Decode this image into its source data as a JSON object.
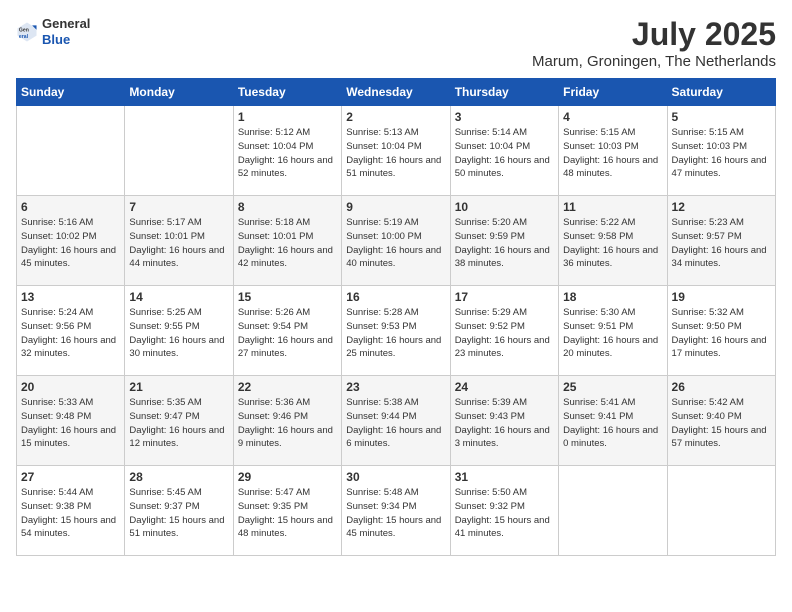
{
  "header": {
    "logo": {
      "general": "General",
      "blue": "Blue"
    },
    "title": "July 2025",
    "location": "Marum, Groningen, The Netherlands"
  },
  "calendar": {
    "weekdays": [
      "Sunday",
      "Monday",
      "Tuesday",
      "Wednesday",
      "Thursday",
      "Friday",
      "Saturday"
    ],
    "weeks": [
      [
        {
          "day": "",
          "sunrise": "",
          "sunset": "",
          "daylight": ""
        },
        {
          "day": "",
          "sunrise": "",
          "sunset": "",
          "daylight": ""
        },
        {
          "day": "1",
          "sunrise": "Sunrise: 5:12 AM",
          "sunset": "Sunset: 10:04 PM",
          "daylight": "Daylight: 16 hours and 52 minutes."
        },
        {
          "day": "2",
          "sunrise": "Sunrise: 5:13 AM",
          "sunset": "Sunset: 10:04 PM",
          "daylight": "Daylight: 16 hours and 51 minutes."
        },
        {
          "day": "3",
          "sunrise": "Sunrise: 5:14 AM",
          "sunset": "Sunset: 10:04 PM",
          "daylight": "Daylight: 16 hours and 50 minutes."
        },
        {
          "day": "4",
          "sunrise": "Sunrise: 5:15 AM",
          "sunset": "Sunset: 10:03 PM",
          "daylight": "Daylight: 16 hours and 48 minutes."
        },
        {
          "day": "5",
          "sunrise": "Sunrise: 5:15 AM",
          "sunset": "Sunset: 10:03 PM",
          "daylight": "Daylight: 16 hours and 47 minutes."
        }
      ],
      [
        {
          "day": "6",
          "sunrise": "Sunrise: 5:16 AM",
          "sunset": "Sunset: 10:02 PM",
          "daylight": "Daylight: 16 hours and 45 minutes."
        },
        {
          "day": "7",
          "sunrise": "Sunrise: 5:17 AM",
          "sunset": "Sunset: 10:01 PM",
          "daylight": "Daylight: 16 hours and 44 minutes."
        },
        {
          "day": "8",
          "sunrise": "Sunrise: 5:18 AM",
          "sunset": "Sunset: 10:01 PM",
          "daylight": "Daylight: 16 hours and 42 minutes."
        },
        {
          "day": "9",
          "sunrise": "Sunrise: 5:19 AM",
          "sunset": "Sunset: 10:00 PM",
          "daylight": "Daylight: 16 hours and 40 minutes."
        },
        {
          "day": "10",
          "sunrise": "Sunrise: 5:20 AM",
          "sunset": "Sunset: 9:59 PM",
          "daylight": "Daylight: 16 hours and 38 minutes."
        },
        {
          "day": "11",
          "sunrise": "Sunrise: 5:22 AM",
          "sunset": "Sunset: 9:58 PM",
          "daylight": "Daylight: 16 hours and 36 minutes."
        },
        {
          "day": "12",
          "sunrise": "Sunrise: 5:23 AM",
          "sunset": "Sunset: 9:57 PM",
          "daylight": "Daylight: 16 hours and 34 minutes."
        }
      ],
      [
        {
          "day": "13",
          "sunrise": "Sunrise: 5:24 AM",
          "sunset": "Sunset: 9:56 PM",
          "daylight": "Daylight: 16 hours and 32 minutes."
        },
        {
          "day": "14",
          "sunrise": "Sunrise: 5:25 AM",
          "sunset": "Sunset: 9:55 PM",
          "daylight": "Daylight: 16 hours and 30 minutes."
        },
        {
          "day": "15",
          "sunrise": "Sunrise: 5:26 AM",
          "sunset": "Sunset: 9:54 PM",
          "daylight": "Daylight: 16 hours and 27 minutes."
        },
        {
          "day": "16",
          "sunrise": "Sunrise: 5:28 AM",
          "sunset": "Sunset: 9:53 PM",
          "daylight": "Daylight: 16 hours and 25 minutes."
        },
        {
          "day": "17",
          "sunrise": "Sunrise: 5:29 AM",
          "sunset": "Sunset: 9:52 PM",
          "daylight": "Daylight: 16 hours and 23 minutes."
        },
        {
          "day": "18",
          "sunrise": "Sunrise: 5:30 AM",
          "sunset": "Sunset: 9:51 PM",
          "daylight": "Daylight: 16 hours and 20 minutes."
        },
        {
          "day": "19",
          "sunrise": "Sunrise: 5:32 AM",
          "sunset": "Sunset: 9:50 PM",
          "daylight": "Daylight: 16 hours and 17 minutes."
        }
      ],
      [
        {
          "day": "20",
          "sunrise": "Sunrise: 5:33 AM",
          "sunset": "Sunset: 9:48 PM",
          "daylight": "Daylight: 16 hours and 15 minutes."
        },
        {
          "day": "21",
          "sunrise": "Sunrise: 5:35 AM",
          "sunset": "Sunset: 9:47 PM",
          "daylight": "Daylight: 16 hours and 12 minutes."
        },
        {
          "day": "22",
          "sunrise": "Sunrise: 5:36 AM",
          "sunset": "Sunset: 9:46 PM",
          "daylight": "Daylight: 16 hours and 9 minutes."
        },
        {
          "day": "23",
          "sunrise": "Sunrise: 5:38 AM",
          "sunset": "Sunset: 9:44 PM",
          "daylight": "Daylight: 16 hours and 6 minutes."
        },
        {
          "day": "24",
          "sunrise": "Sunrise: 5:39 AM",
          "sunset": "Sunset: 9:43 PM",
          "daylight": "Daylight: 16 hours and 3 minutes."
        },
        {
          "day": "25",
          "sunrise": "Sunrise: 5:41 AM",
          "sunset": "Sunset: 9:41 PM",
          "daylight": "Daylight: 16 hours and 0 minutes."
        },
        {
          "day": "26",
          "sunrise": "Sunrise: 5:42 AM",
          "sunset": "Sunset: 9:40 PM",
          "daylight": "Daylight: 15 hours and 57 minutes."
        }
      ],
      [
        {
          "day": "27",
          "sunrise": "Sunrise: 5:44 AM",
          "sunset": "Sunset: 9:38 PM",
          "daylight": "Daylight: 15 hours and 54 minutes."
        },
        {
          "day": "28",
          "sunrise": "Sunrise: 5:45 AM",
          "sunset": "Sunset: 9:37 PM",
          "daylight": "Daylight: 15 hours and 51 minutes."
        },
        {
          "day": "29",
          "sunrise": "Sunrise: 5:47 AM",
          "sunset": "Sunset: 9:35 PM",
          "daylight": "Daylight: 15 hours and 48 minutes."
        },
        {
          "day": "30",
          "sunrise": "Sunrise: 5:48 AM",
          "sunset": "Sunset: 9:34 PM",
          "daylight": "Daylight: 15 hours and 45 minutes."
        },
        {
          "day": "31",
          "sunrise": "Sunrise: 5:50 AM",
          "sunset": "Sunset: 9:32 PM",
          "daylight": "Daylight: 15 hours and 41 minutes."
        },
        {
          "day": "",
          "sunrise": "",
          "sunset": "",
          "daylight": ""
        },
        {
          "day": "",
          "sunrise": "",
          "sunset": "",
          "daylight": ""
        }
      ]
    ]
  }
}
